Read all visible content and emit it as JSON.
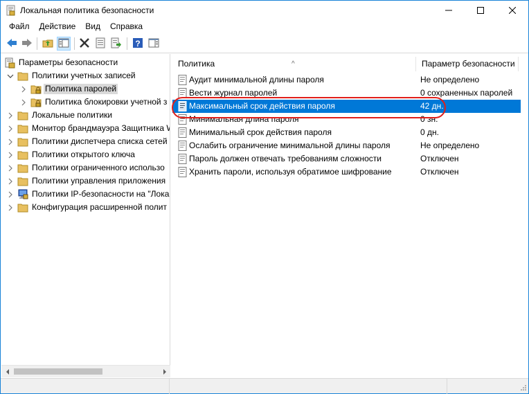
{
  "window": {
    "title": "Локальная политика безопасности",
    "minimize_label": "—",
    "maximize_label": "☐",
    "close_label": "✕"
  },
  "menu": [
    {
      "label": "Файл"
    },
    {
      "label": "Действие"
    },
    {
      "label": "Вид"
    },
    {
      "label": "Справка"
    }
  ],
  "toolbar": {
    "icons": [
      "back-icon",
      "forward-icon",
      "up-folder-icon",
      "show-hide-tree-icon",
      "delete-icon",
      "properties-icon",
      "export-list-icon",
      "help-icon",
      "show-hide-action-pane-icon"
    ]
  },
  "tree": {
    "items": [
      {
        "label": "Параметры безопасности",
        "level": 0,
        "expanded": true
      },
      {
        "label": "Политики учетных записей",
        "level": 1,
        "expanded": true
      },
      {
        "label": "Политика паролей",
        "level": 2,
        "selected": true
      },
      {
        "label": "Политика блокировки учетной з",
        "level": 2
      },
      {
        "label": "Локальные политики",
        "level": 1
      },
      {
        "label": "Монитор брандмауэра Защитника W",
        "level": 1
      },
      {
        "label": "Политики диспетчера списка сетей",
        "level": 1
      },
      {
        "label": "Политики открытого ключа",
        "level": 1
      },
      {
        "label": "Политики ограниченного использо",
        "level": 1
      },
      {
        "label": "Политики управления приложения",
        "level": 1
      },
      {
        "label": "Политики IP-безопасности на \"Лока",
        "level": 1
      },
      {
        "label": "Конфигурация расширенной полит",
        "level": 1
      }
    ]
  },
  "list": {
    "columns": {
      "policy": "Политика",
      "setting": "Параметр безопасности"
    },
    "sort_indicator": "^",
    "rows": [
      {
        "name": "Аудит минимальной длины пароля",
        "value": "Не определено"
      },
      {
        "name": "Вести журнал паролей",
        "value": "0 сохраненных паролей"
      },
      {
        "name": "Максимальный срок действия пароля",
        "value": "42 дн.",
        "selected": true
      },
      {
        "name": "Минимальная длина пароля",
        "value": "0 зн."
      },
      {
        "name": "Минимальный срок действия пароля",
        "value": "0 дн."
      },
      {
        "name": "Ослабить ограничение минимальной длины пароля",
        "value": "Не определено"
      },
      {
        "name": "Пароль должен отвечать требованиям сложности",
        "value": "Отключен"
      },
      {
        "name": "Хранить пароли, используя обратимое шифрование",
        "value": "Отключен"
      }
    ]
  },
  "colors": {
    "selection": "#0078d7",
    "highlight_ellipse": "#e0201b",
    "folder": "#e8c060",
    "window_border": "#1883d7"
  }
}
